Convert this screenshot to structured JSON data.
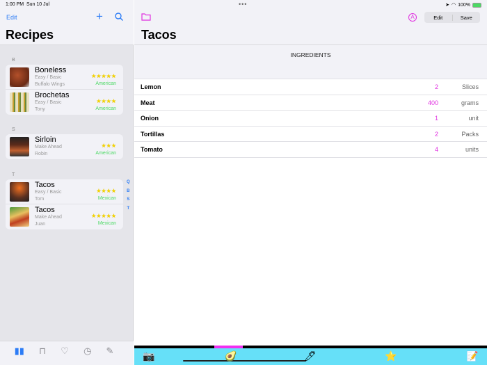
{
  "status": {
    "time": "1:00 PM",
    "date": "Sun 10 Jul",
    "battery": "100%"
  },
  "sidebar": {
    "edit": "Edit",
    "title": "Recipes",
    "sections": [
      {
        "letter": "B",
        "recipes": [
          {
            "name": "Boneless",
            "difficulty": "Easy / Basic",
            "author": "Buffalo Wings",
            "stars": "★★★★★",
            "category": "American"
          },
          {
            "name": "Brochetas",
            "difficulty": "Easy / Basic",
            "author": "Tony",
            "stars": "★★★★",
            "category": "American"
          }
        ]
      },
      {
        "letter": "S",
        "recipes": [
          {
            "name": "Sirloin",
            "difficulty": "Make Ahead",
            "author": "Robin",
            "stars": "★★★",
            "category": "American"
          }
        ]
      },
      {
        "letter": "T",
        "recipes": [
          {
            "name": "Tacos",
            "difficulty": "Easy / Basic",
            "author": "Tom",
            "stars": "★★★★",
            "category": "Mexican"
          },
          {
            "name": "Tacos",
            "difficulty": "Make Ahead",
            "author": "Juan",
            "stars": "★★★★★",
            "category": "Mexican"
          }
        ]
      }
    ],
    "index": [
      "Q",
      "B",
      "S",
      "T"
    ]
  },
  "detail": {
    "title": "Tacos",
    "edit": "Edit",
    "save": "Save",
    "section": "INGREDIENTS",
    "ingredients": [
      {
        "name": "Lemon",
        "qty": "2",
        "unit": "Slices"
      },
      {
        "name": "Meat",
        "qty": "400",
        "unit": "grams"
      },
      {
        "name": "Onion",
        "qty": "1",
        "unit": "unit"
      },
      {
        "name": "Tortillas",
        "qty": "2",
        "unit": "Packs"
      },
      {
        "name": "Tomato",
        "qty": "4",
        "unit": "units"
      }
    ]
  },
  "colors": {
    "accent": "#2c7cf6",
    "magenta": "#e030e0",
    "toolbar": "#66e0f8",
    "category": "#4cd964"
  }
}
